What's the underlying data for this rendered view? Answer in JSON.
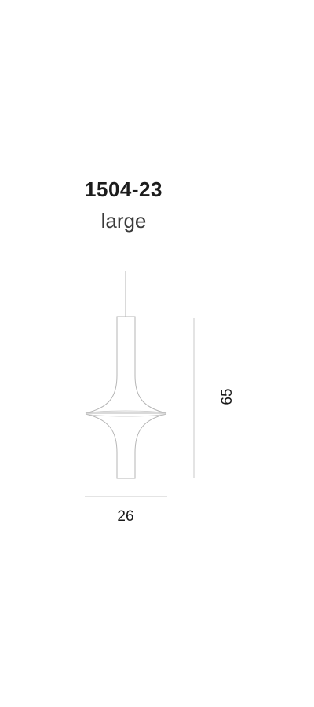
{
  "product": {
    "code": "1504-23",
    "size": "large"
  },
  "dimensions": {
    "width": "26",
    "height": "65"
  }
}
